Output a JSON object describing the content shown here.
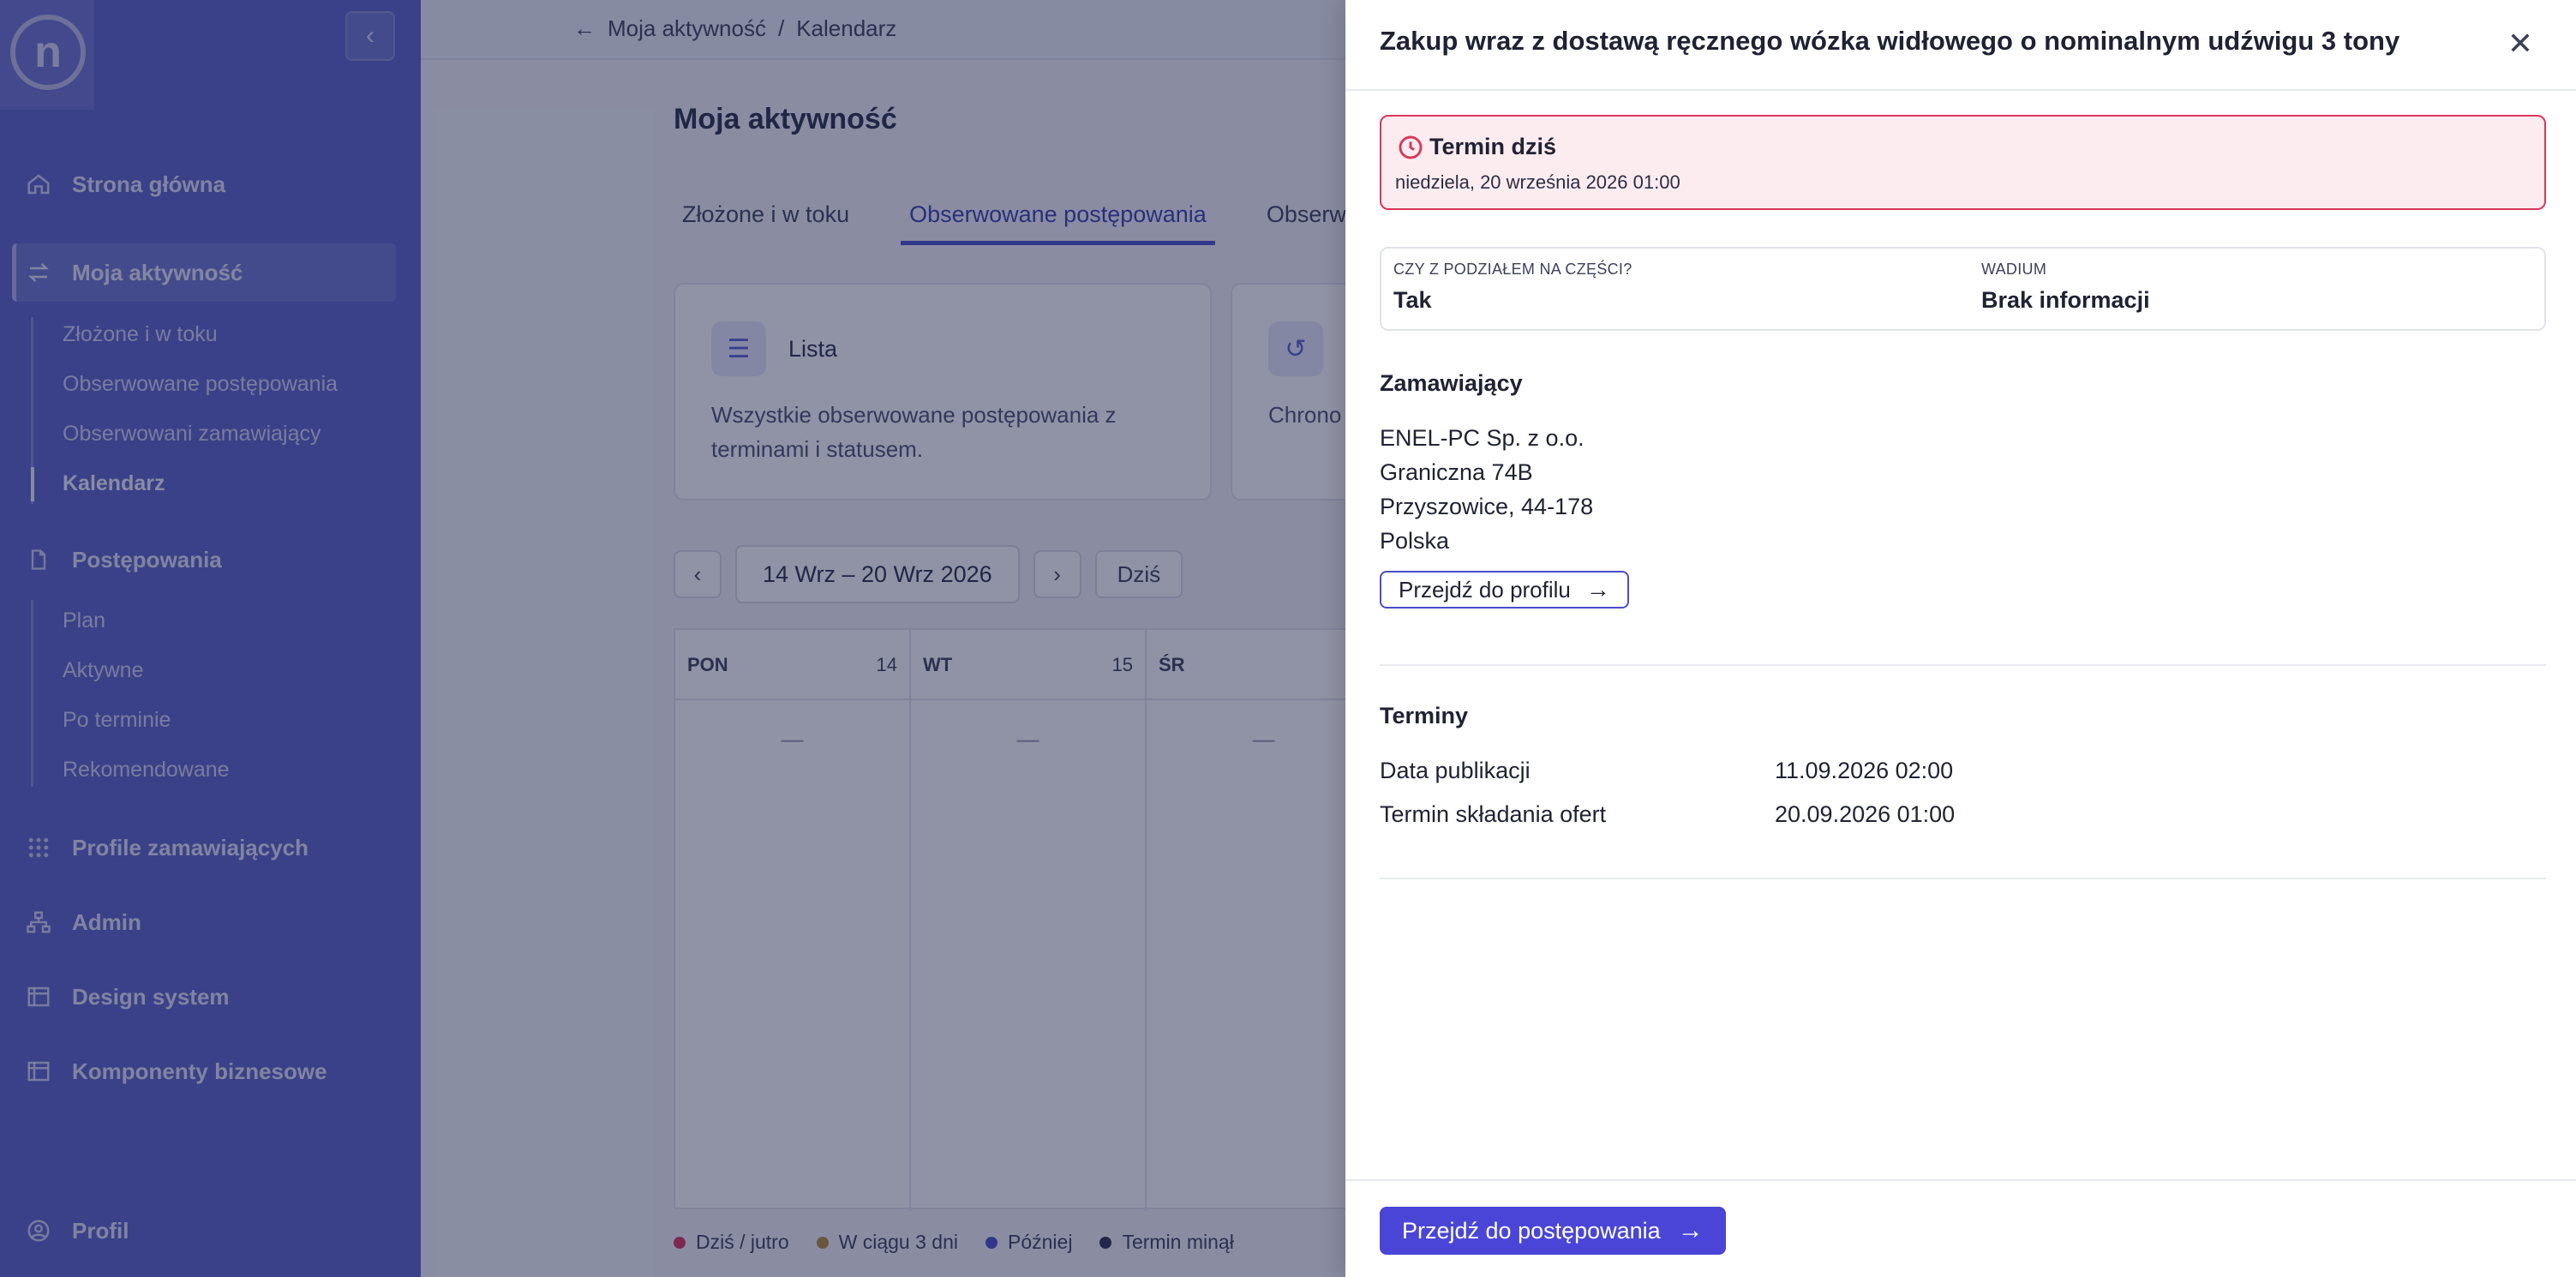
{
  "sidebar": {
    "logo_letter": "n",
    "collapse_icon": "chevron-left-icon",
    "items": [
      {
        "label": "Strona główna",
        "icon": "home-icon"
      },
      {
        "label": "Moja aktywność",
        "icon": "swap-arrows-icon"
      },
      {
        "label": "Postępowania",
        "icon": "document-icon"
      },
      {
        "label": "Profile zamawiających",
        "icon": "grid-icon"
      },
      {
        "label": "Admin",
        "icon": "hierarchy-icon"
      },
      {
        "label": "Design system",
        "icon": "frame-icon"
      },
      {
        "label": "Komponenty biznesowe",
        "icon": "frame-icon"
      }
    ],
    "activity_sub": [
      "Złożone i w toku",
      "Obserwowane postępowania",
      "Obserwowani zamawiający",
      "Kalendarz"
    ],
    "proceedings_sub": [
      "Plan",
      "Aktywne",
      "Po terminie",
      "Rekomendowane"
    ],
    "profile_label": "Profil"
  },
  "main": {
    "breadcrumb": {
      "back": "Moja aktywność",
      "separator": "/",
      "current": "Kalendarz"
    },
    "page_title": "Moja aktywność",
    "tabs": [
      "Złożone i w toku",
      "Obserwowane postępowania",
      "Obserwow"
    ],
    "cards": [
      {
        "title": "Lista",
        "desc": "Wszystkie obserwowane postępowania z terminami i statusem."
      },
      {
        "title": "",
        "desc": "Chrono postępo"
      }
    ],
    "week_range": "14 Wrz – 20 Wrz 2026",
    "today_label": "Dziś",
    "days": [
      {
        "name": "PON",
        "num": "14",
        "empty": "—"
      },
      {
        "name": "WT",
        "num": "15",
        "empty": "—"
      },
      {
        "name": "ŚR",
        "num": "",
        "empty": "—"
      }
    ],
    "legend": [
      {
        "label": "Dziś / jutro",
        "color": "#d9375a"
      },
      {
        "label": "W ciągu 3 dni",
        "color": "#b88a3a"
      },
      {
        "label": "Później",
        "color": "#4a4fc7"
      },
      {
        "label": "Termin minął",
        "color": "#2e3350"
      }
    ]
  },
  "drawer": {
    "title": "Zakup wraz z dostawą ręcznego wózka widłowego o nominalnym udźwigu 3 tony",
    "alert": {
      "title": "Termin dziś",
      "date": "niedziela, 20 września 2026 01:00",
      "color": "#d9375a"
    },
    "info": [
      {
        "label": "CZY Z PODZIAŁEM NA CZĘŚCI?",
        "value": "Tak"
      },
      {
        "label": "WADIUM",
        "value": "Brak informacji"
      }
    ],
    "buyer": {
      "heading": "Zamawiający",
      "name": "ENEL-PC Sp. z o.o.",
      "street": "Graniczna 74B",
      "city": "Przyszowice, 44-178",
      "country": "Polska",
      "profile_button": "Przejdź do profilu"
    },
    "terms": {
      "heading": "Terminy",
      "rows": [
        {
          "label": "Data publikacji",
          "value": "11.09.2026 02:00"
        },
        {
          "label": "Termin składania ofert",
          "value": "20.09.2026 01:00"
        }
      ]
    },
    "footer_button": "Przejdź do postępowania",
    "accent": "#4a45d6"
  }
}
